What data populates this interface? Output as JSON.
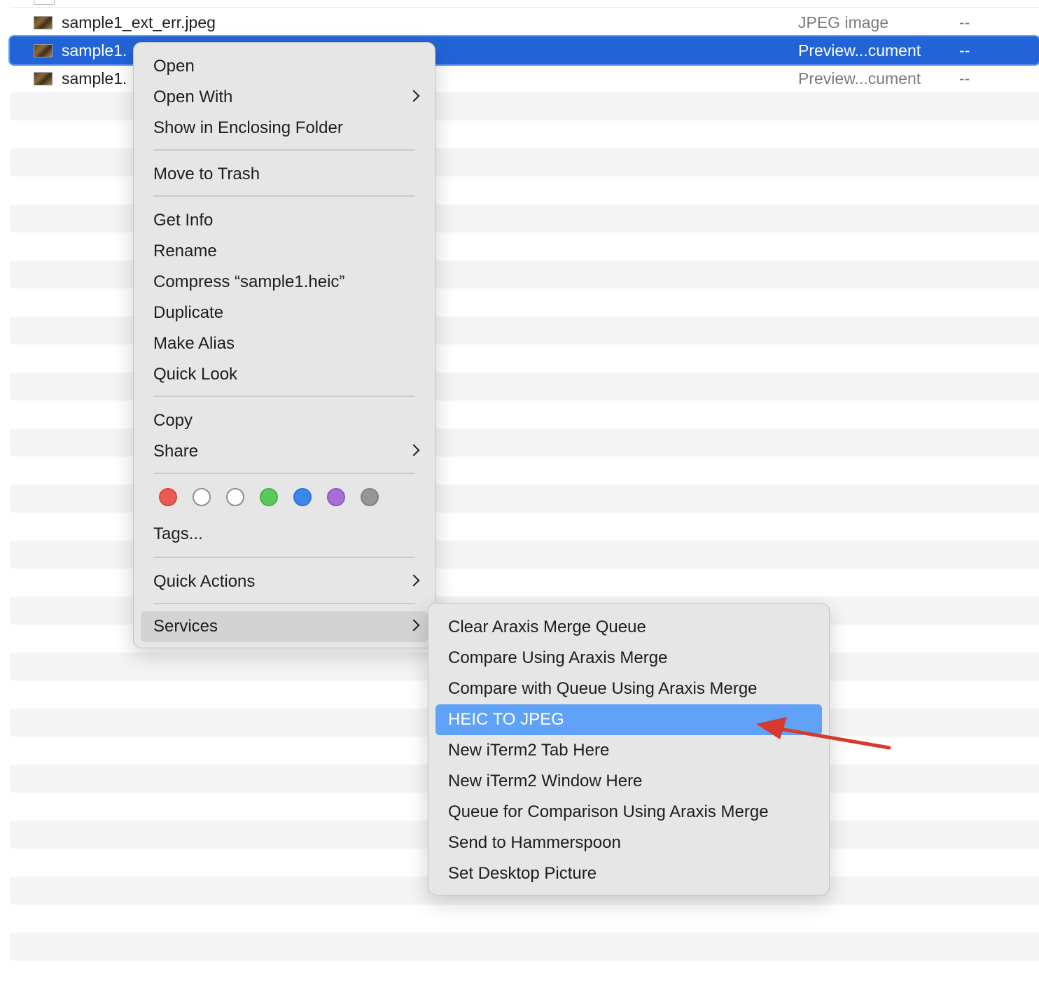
{
  "files": [
    {
      "name": "sample1_ext_err.jpeg",
      "kind": "JPEG image",
      "size": "--",
      "selected": false
    },
    {
      "name": "sample1.",
      "kind": "Preview...cument",
      "size": "--",
      "selected": true
    },
    {
      "name": "sample1.",
      "kind": "Preview...cument",
      "size": "--",
      "selected": false
    }
  ],
  "context_menu": {
    "items": [
      {
        "label": "Open"
      },
      {
        "label": "Open With",
        "submenu": true
      },
      {
        "label": "Show in Enclosing Folder"
      },
      {
        "label": "Move to Trash"
      },
      {
        "label": "Get Info"
      },
      {
        "label": "Rename"
      },
      {
        "label": "Compress “sample1.heic”"
      },
      {
        "label": "Duplicate"
      },
      {
        "label": "Make Alias"
      },
      {
        "label": "Quick Look"
      },
      {
        "label": "Copy"
      },
      {
        "label": "Share",
        "submenu": true
      },
      {
        "label": "Tags..."
      },
      {
        "label": "Quick Actions",
        "submenu": true
      },
      {
        "label": "Services",
        "submenu": true,
        "active": true
      }
    ],
    "tag_colors": [
      {
        "name": "red-tag",
        "fill": "#ec5b52",
        "border": "#d24a42"
      },
      {
        "name": "empty-tag",
        "fill": "#ffffff",
        "border": "#8e8e8e"
      },
      {
        "name": "empty-tag",
        "fill": "#ffffff",
        "border": "#8e8e8e"
      },
      {
        "name": "green-tag",
        "fill": "#5ac85a",
        "border": "#48b248"
      },
      {
        "name": "blue-tag",
        "fill": "#3c87ec",
        "border": "#2f74d6"
      },
      {
        "name": "purple-tag",
        "fill": "#a66fd6",
        "border": "#9059c2"
      },
      {
        "name": "gray-tag",
        "fill": "#969696",
        "border": "#828282"
      }
    ]
  },
  "services_menu": {
    "items": [
      {
        "label": "Clear Araxis Merge Queue"
      },
      {
        "label": "Compare Using Araxis Merge"
      },
      {
        "label": "Compare with Queue Using Araxis Merge"
      },
      {
        "label": "HEIC TO JPEG",
        "highlighted": true
      },
      {
        "label": "New iTerm2 Tab Here"
      },
      {
        "label": "New iTerm2 Window Here"
      },
      {
        "label": "Queue for Comparison Using Araxis Merge"
      },
      {
        "label": "Send to Hammerspoon"
      },
      {
        "label": "Set Desktop Picture"
      }
    ]
  },
  "colors": {
    "selection": "#2264d8",
    "highlight": "#5fa2f7",
    "annotation_arrow": "#d63a2c"
  }
}
